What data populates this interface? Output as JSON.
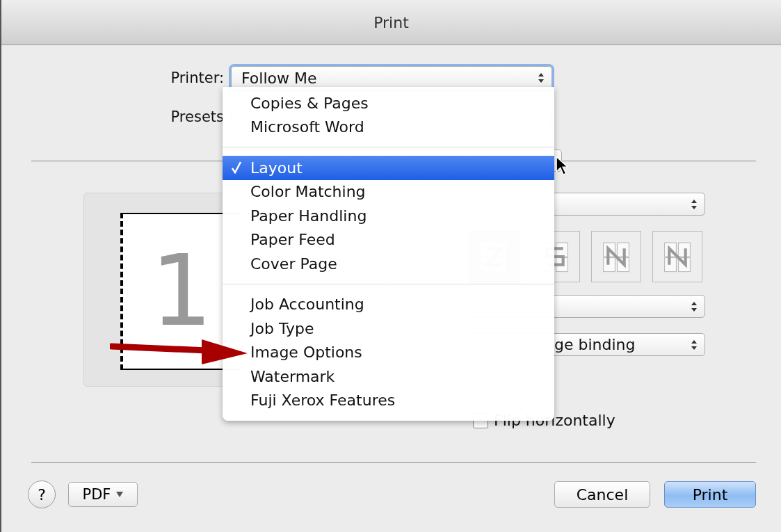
{
  "window": {
    "title": "Print"
  },
  "printer": {
    "label": "Printer:",
    "value": "Follow Me"
  },
  "presets": {
    "label": "Presets"
  },
  "menu": {
    "items": [
      {
        "kind": "item",
        "label": "Copies & Pages",
        "selected": false
      },
      {
        "kind": "item",
        "label": "Microsoft Word",
        "selected": false
      },
      {
        "kind": "separator"
      },
      {
        "kind": "item",
        "label": "Layout",
        "selected": true
      },
      {
        "kind": "item",
        "label": "Color Matching",
        "selected": false
      },
      {
        "kind": "item",
        "label": "Paper Handling",
        "selected": false
      },
      {
        "kind": "item",
        "label": "Paper Feed",
        "selected": false
      },
      {
        "kind": "item",
        "label": "Cover Page",
        "selected": false
      },
      {
        "kind": "separator"
      },
      {
        "kind": "item",
        "label": "Job Accounting",
        "selected": false
      },
      {
        "kind": "item",
        "label": "Job Type",
        "selected": false
      },
      {
        "kind": "item",
        "label": "Image Options",
        "selected": false
      },
      {
        "kind": "item",
        "label": "Watermark",
        "selected": false
      },
      {
        "kind": "item",
        "label": "Fuji Xerox Features",
        "selected": false
      }
    ]
  },
  "preview": {
    "page_number": "1"
  },
  "layout": {
    "two_sided_value": "ge binding",
    "flip_horizontally": {
      "label": "Flip horizontally",
      "checked": false
    }
  },
  "footer": {
    "help": "?",
    "pdf": "PDF",
    "cancel": "Cancel",
    "print": "Print"
  }
}
